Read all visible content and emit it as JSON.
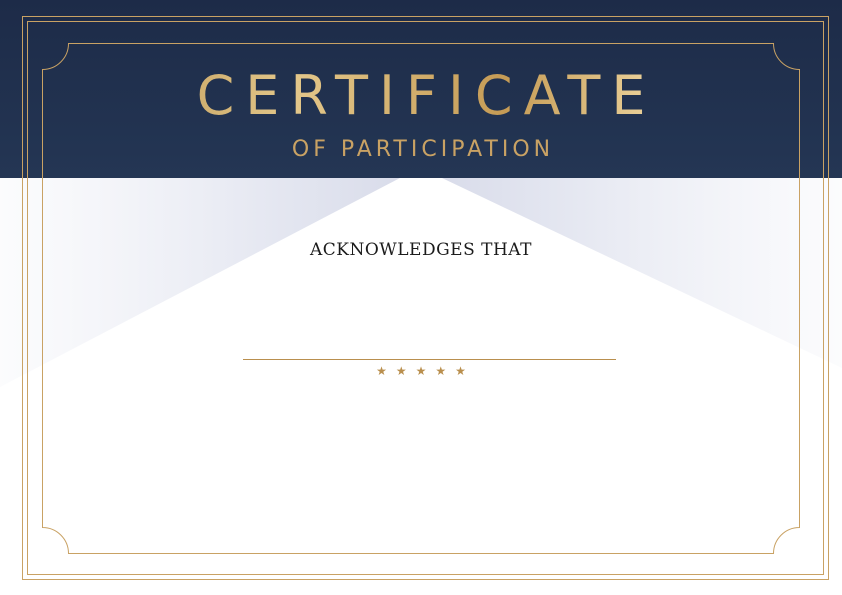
{
  "certificate": {
    "title": "CERTIFICATE",
    "subtitle": "OF PARTICIPATION",
    "acknowledgement": "ACKNOWLEDGES THAT",
    "stars": "★★★★★",
    "star_count": 5
  },
  "colors": {
    "navy": "#1f2e4c",
    "gold": "#c9a264",
    "gold_line": "#b98f4e",
    "light_panel": "#e4e6f0"
  }
}
